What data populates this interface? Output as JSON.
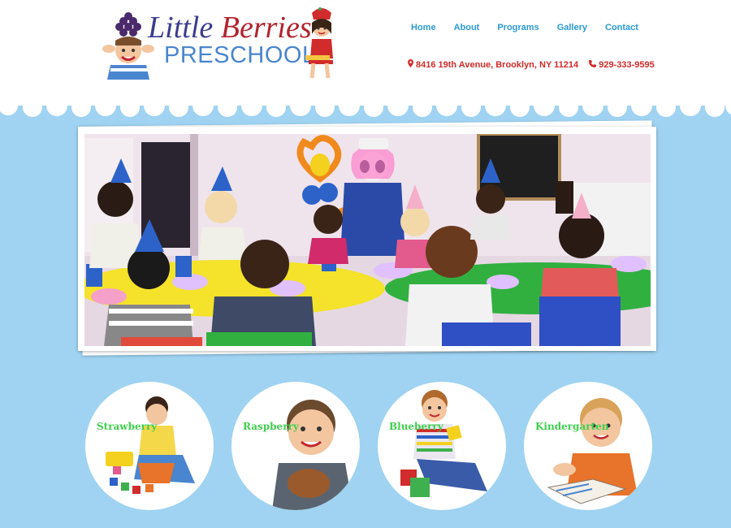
{
  "logo": {
    "script_part1": "Little",
    "script_part2": "Berries",
    "main": "PRESCHOOL"
  },
  "nav": {
    "items": [
      {
        "label": "Home"
      },
      {
        "label": "About"
      },
      {
        "label": "Programs"
      },
      {
        "label": "Gallery"
      },
      {
        "label": "Contact"
      }
    ]
  },
  "contact": {
    "address": "8416 19th Avenue, Brooklyn, NY 11214",
    "phone": "929-333-9595"
  },
  "programs": [
    {
      "label": "Strawberry"
    },
    {
      "label": "Raspberry"
    },
    {
      "label": "Blueberry"
    },
    {
      "label": "Kindergarten"
    }
  ],
  "colors": {
    "background": "#9fd3f1",
    "nav": "#2a9ad8",
    "contact": "#d12b2b",
    "program_label": "#3fd04e"
  }
}
